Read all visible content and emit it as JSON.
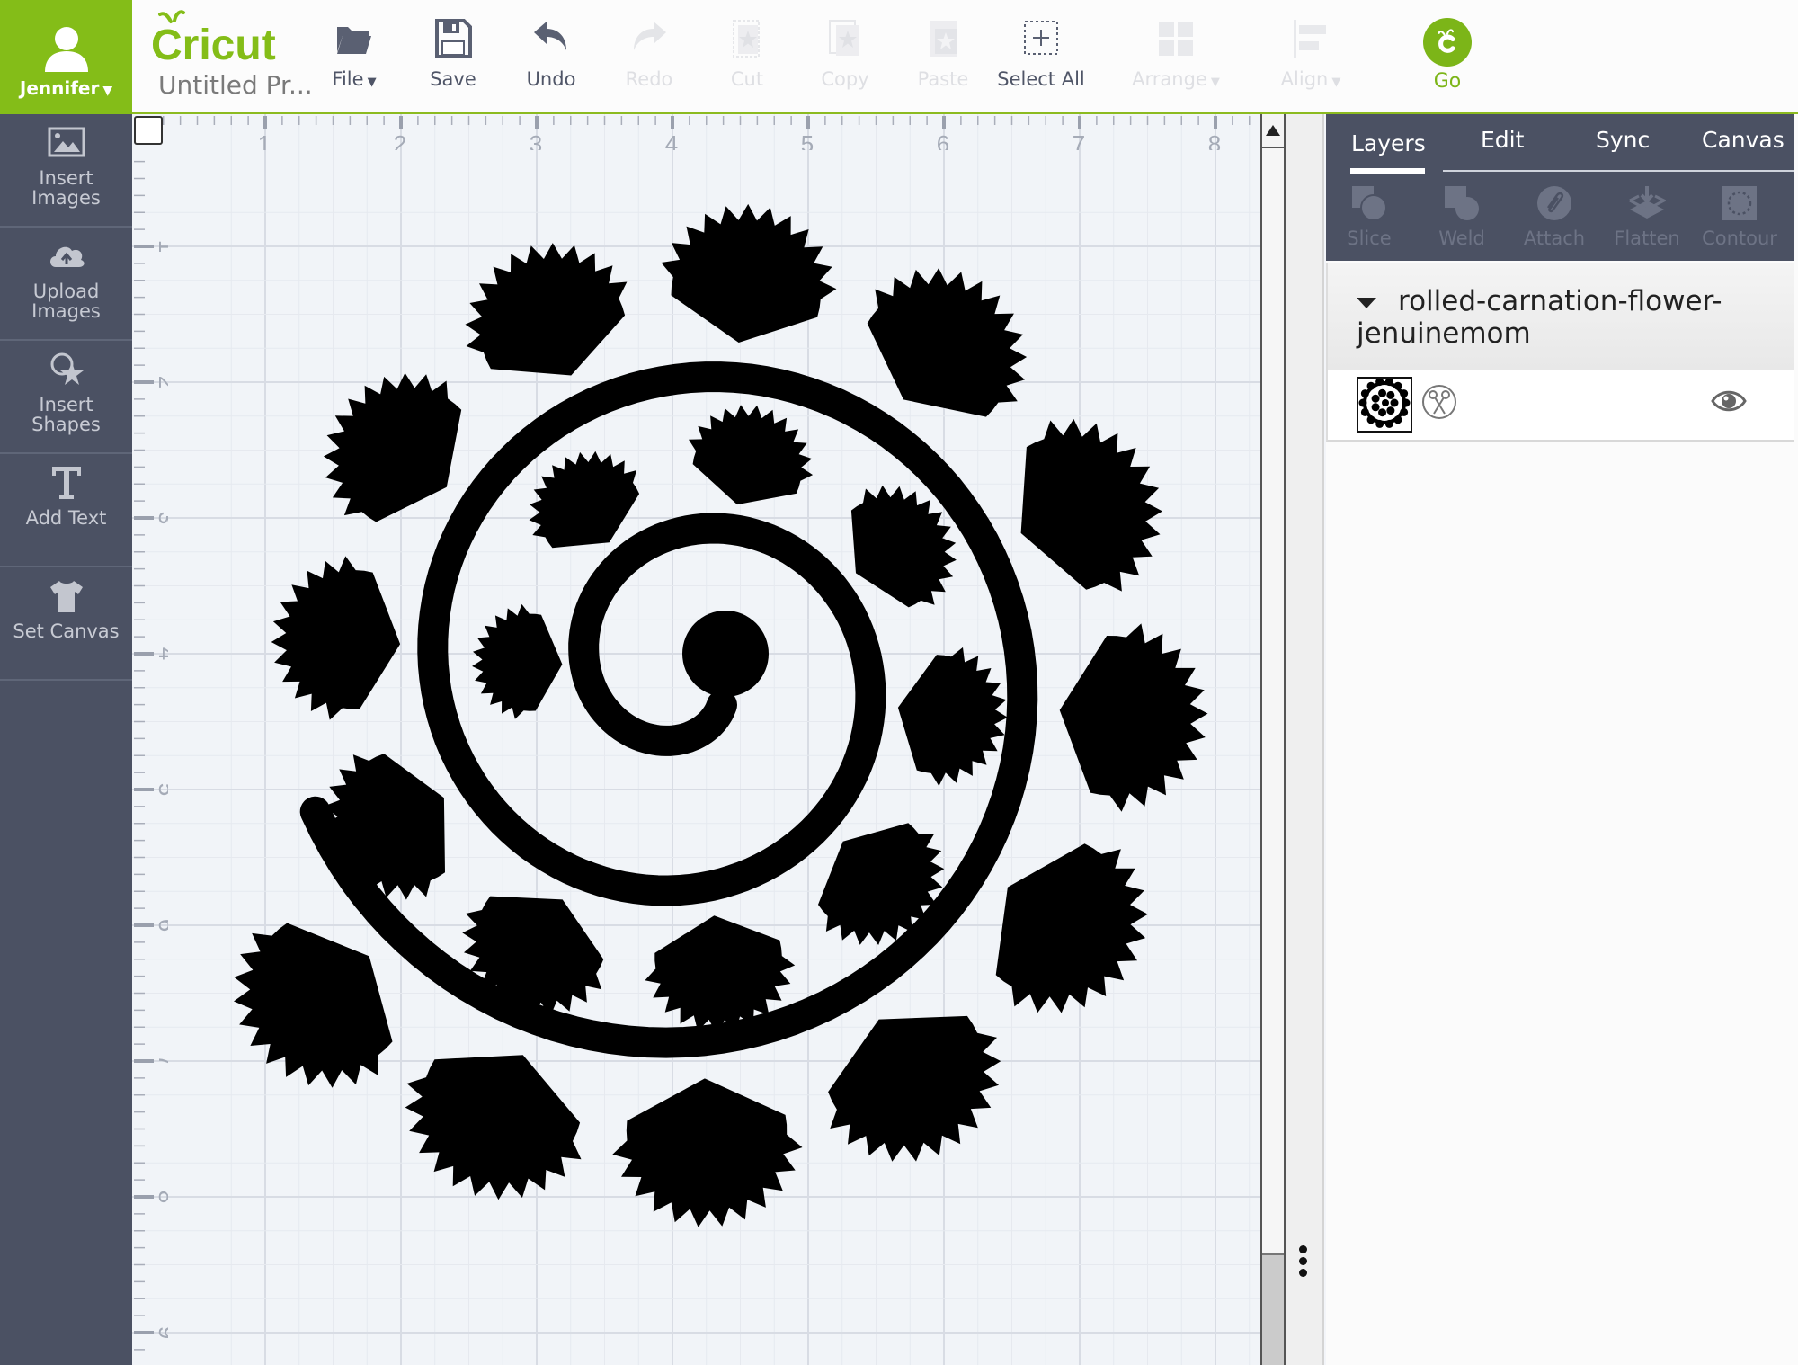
{
  "user": {
    "name": "Jennifer",
    "icon": "user-icon"
  },
  "brand": {
    "logo_text": "Cricut",
    "accent": "#84bd18",
    "go_color": "#7cb518"
  },
  "project": {
    "title": "Untitled Pr..."
  },
  "toolbar": {
    "items": [
      {
        "id": "file",
        "label": "File",
        "icon": "folder-icon",
        "enabled": true,
        "dropdown": true
      },
      {
        "id": "save",
        "label": "Save",
        "icon": "floppy-disk-icon",
        "enabled": true
      },
      {
        "id": "undo",
        "label": "Undo",
        "icon": "undo-arrow-icon",
        "enabled": true
      },
      {
        "id": "redo",
        "label": "Redo",
        "icon": "redo-arrow-icon",
        "enabled": false
      },
      {
        "id": "cut",
        "label": "Cut",
        "icon": "cut-icon",
        "enabled": false
      },
      {
        "id": "copy",
        "label": "Copy",
        "icon": "copy-icon",
        "enabled": false
      },
      {
        "id": "paste",
        "label": "Paste",
        "icon": "paste-icon",
        "enabled": false
      },
      {
        "id": "select_all",
        "label": "Select All",
        "icon": "select-all-icon",
        "enabled": true
      },
      {
        "id": "arrange",
        "label": "Arrange",
        "icon": "arrange-icon",
        "enabled": false,
        "dropdown": true
      },
      {
        "id": "align",
        "label": "Align",
        "icon": "align-icon",
        "enabled": false,
        "dropdown": true
      }
    ],
    "go_label": "Go"
  },
  "sidebar": {
    "items": [
      {
        "label_line1": "Insert",
        "label_line2": "Images",
        "icon": "image-icon"
      },
      {
        "label_line1": "Upload",
        "label_line2": "Images",
        "icon": "cloud-upload-icon"
      },
      {
        "label_line1": "Insert",
        "label_line2": "Shapes",
        "icon": "shapes-icon"
      },
      {
        "label_line1": "Add Text",
        "label_line2": "",
        "icon": "text-t-icon"
      },
      {
        "label_line1": "Set Canvas",
        "label_line2": "",
        "icon": "tshirt-icon"
      }
    ]
  },
  "canvas": {
    "ruler_units": "in",
    "h_ruler_labels": [
      "1",
      "2",
      "3",
      "4",
      "5",
      "6",
      "7",
      "8"
    ],
    "v_ruler_labels": [
      "1",
      "2",
      "3",
      "4",
      "5",
      "6",
      "7",
      "8",
      "9"
    ],
    "design_name": "rolled-carnation-flower-jenuinemom"
  },
  "panel": {
    "tabs": [
      {
        "label": "Layers",
        "active": true
      },
      {
        "label": "Edit",
        "active": false
      },
      {
        "label": "Sync",
        "active": false
      },
      {
        "label": "Canvas",
        "active": false
      }
    ],
    "tools": [
      {
        "label": "Slice",
        "icon": "slice-icon",
        "enabled": false
      },
      {
        "label": "Weld",
        "icon": "weld-icon",
        "enabled": false
      },
      {
        "label": "Attach",
        "icon": "paperclip-icon",
        "enabled": false
      },
      {
        "label": "Flatten",
        "icon": "flatten-icon",
        "enabled": false
      },
      {
        "label": "Contour",
        "icon": "contour-icon",
        "enabled": false
      }
    ],
    "layers": [
      {
        "group_name": "rolled-carnation-flower-jenuinemom",
        "expanded": true,
        "operation": "cut",
        "visible": true
      }
    ]
  }
}
